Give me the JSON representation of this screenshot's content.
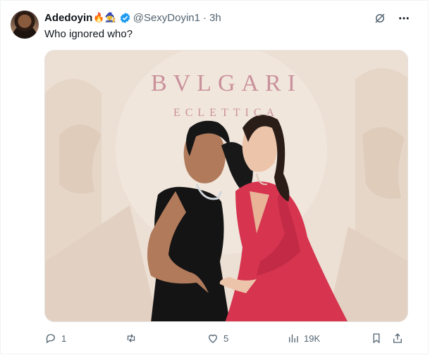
{
  "tweet": {
    "author_name": "Adedoyin",
    "author_emojis": "🔥🧙‍♀️",
    "handle": "@SexyDoyin1",
    "separator": "·",
    "time": "3h",
    "text": "Who ignored who?"
  },
  "media": {
    "brand": "BVLGARI",
    "subtitle": "ECLETTICA"
  },
  "actions": {
    "replies": "1",
    "retweets": "",
    "likes": "5",
    "views": "19K"
  },
  "icons": [
    "grok-icon",
    "more-icon",
    "reply-icon",
    "retweet-icon",
    "like-icon",
    "views-icon",
    "bookmark-icon",
    "share-icon",
    "verified-badge-icon"
  ],
  "colors": {
    "accent": "#1d9bf0",
    "muted": "#536471",
    "brand_pink": "#c9919c",
    "dress_red": "#d6344f"
  }
}
